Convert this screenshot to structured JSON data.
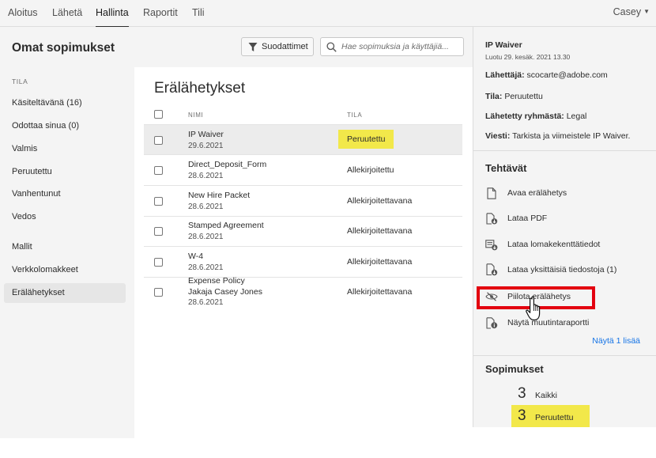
{
  "topnav": {
    "tabs": [
      {
        "label": "Aloitus",
        "active": false
      },
      {
        "label": "Lähetä",
        "active": false
      },
      {
        "label": "Hallinta",
        "active": true
      },
      {
        "label": "Raportit",
        "active": false
      },
      {
        "label": "Tili",
        "active": false
      }
    ],
    "user": "Casey"
  },
  "page": {
    "title": "Omat sopimukset",
    "filters_label": "Suodattimet",
    "search_placeholder": "Hae sopimuksia ja käyttäjiä..."
  },
  "sidebar": {
    "section_label": "TILA",
    "items": [
      {
        "label": "Käsiteltävänä (16)",
        "active": false
      },
      {
        "label": "Odottaa sinua (0)",
        "active": false
      },
      {
        "label": "Valmis",
        "active": false
      },
      {
        "label": "Peruutettu",
        "active": false
      },
      {
        "label": "Vanhentunut",
        "active": false
      },
      {
        "label": "Vedos",
        "active": false
      },
      {
        "label": "Mallit",
        "active": false
      },
      {
        "label": "Verkkolomakkeet",
        "active": false
      },
      {
        "label": "Erälähetykset",
        "active": true
      }
    ]
  },
  "content": {
    "title": "Erälähetykset",
    "columns": {
      "name": "NIMI",
      "status": "TILA"
    },
    "rows": [
      {
        "name": "IP Waiver",
        "sub": "",
        "date": "29.6.2021",
        "status": "Peruutettu",
        "selected": true
      },
      {
        "name": "Direct_Deposit_Form",
        "sub": "",
        "date": "28.6.2021",
        "status": "Allekirjoitettu",
        "selected": false
      },
      {
        "name": "New Hire Packet",
        "sub": "",
        "date": "28.6.2021",
        "status": "Allekirjoitettavana",
        "selected": false
      },
      {
        "name": "Stamped Agreement",
        "sub": "",
        "date": "28.6.2021",
        "status": "Allekirjoitettavana",
        "selected": false
      },
      {
        "name": "W-4",
        "sub": "",
        "date": "28.6.2021",
        "status": "Allekirjoitettavana",
        "selected": false
      },
      {
        "name": "Expense Policy",
        "sub": "Jakaja Casey Jones",
        "date": "28.6.2021",
        "status": "Allekirjoitettavana",
        "selected": false
      }
    ]
  },
  "details": {
    "name": "IP Waiver",
    "created": "Luotu 29. kesäk. 2021 13.30",
    "sender_label": "Lähettäjä:",
    "sender": "scocarte@adobe.com",
    "status_label": "Tila:",
    "status": "Peruutettu",
    "group_label": "Lähetetty ryhmästä:",
    "group": "Legal",
    "message_label": "Viesti:",
    "message": "Tarkista ja viimeistele IP Waiver."
  },
  "tasks": {
    "heading": "Tehtävät",
    "items": [
      {
        "label": "Avaa erälähetys",
        "icon": "document-icon"
      },
      {
        "label": "Lataa PDF",
        "icon": "download-pdf-icon"
      },
      {
        "label": "Lataa lomakekenttätiedot",
        "icon": "form-data-icon"
      },
      {
        "label": "Lataa yksittäisiä tiedostoja (1)",
        "icon": "download-files-icon"
      },
      {
        "label": "Piilota erälähetys",
        "icon": "eye-hidden-icon"
      },
      {
        "label": "Näytä muutintaraportti",
        "icon": "report-icon"
      }
    ],
    "show_more": "Näytä 1 lisää"
  },
  "agreements": {
    "heading": "Sopimukset",
    "items": [
      {
        "count": "3",
        "label": "Kaikki",
        "highlight": false
      },
      {
        "count": "3",
        "label": "Peruutettu",
        "highlight": true
      }
    ]
  },
  "colors": {
    "highlight": "#f2e84a",
    "annotation_red": "#e3000f",
    "link_blue": "#1473e6"
  }
}
